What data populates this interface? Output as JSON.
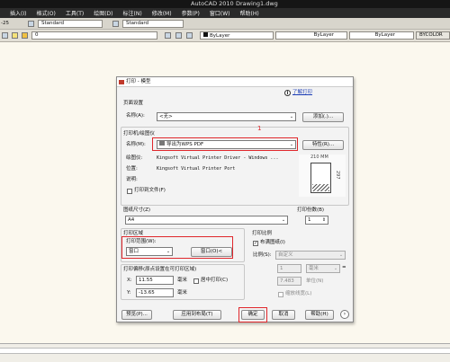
{
  "app": {
    "title": "AutoCAD 2010",
    "file": "Drawing1.dwg"
  },
  "menu": [
    "插入(I)",
    "格式(O)",
    "工具(T)",
    "绘图(D)",
    "标注(N)",
    "修改(M)",
    "参数(P)",
    "窗口(W)",
    "帮助(H)"
  ],
  "toolbar1": {
    "scale_label": "-25",
    "style1": "Standard",
    "style2": "Standard"
  },
  "toolbar2": {
    "layer_value": "0",
    "bylayer1": "ByLayer",
    "bylayer2": "ByLayer",
    "bylayer3": "ByLayer",
    "bycolor": "BYCOLOR"
  },
  "dialog": {
    "title": "打印 - 模型",
    "learn_link": "了解打印",
    "page_setup": {
      "section": "页面设置",
      "name_label": "名称(A):",
      "name_value": "<无>",
      "add_button": "添加(.)..."
    },
    "printer": {
      "section": "打印机/绘图仪",
      "name_label": "名称(M):",
      "name_value": "导出为WPS PDF",
      "properties_button": "特性(R)...",
      "plotter_label": "绘图仪:",
      "plotter_value": "Kingsoft Virtual Printer Driver - Windows ...",
      "location_label": "位置:",
      "location_value": "Kingsoft Virtual Printer Port",
      "description_label": "说明:",
      "print_to_file": "打印到文件(F)",
      "preview_width": "210 MM",
      "preview_height": "297"
    },
    "paper": {
      "section": "图纸尺寸(Z)",
      "value": "A4"
    },
    "copies": {
      "section": "打印份数(B)",
      "value": "1"
    },
    "area": {
      "section": "打印区域",
      "range_label": "打印范围(W):",
      "range_value": "窗口",
      "window_button": "窗口(O)<"
    },
    "offset": {
      "section": "打印偏移(原点设置在可打印区域)",
      "x_label": "X:",
      "x_value": "11.55",
      "x_unit": "毫米",
      "center": "居中打印(C)",
      "y_label": "Y:",
      "y_value": "-13.65",
      "y_unit": "毫米"
    },
    "scale": {
      "section": "打印比例",
      "fit": "布满图纸(I)",
      "ratio_label": "比例(S):",
      "ratio_value": "自定义",
      "val1": "1",
      "unit": "毫米",
      "val2": "7.483",
      "unit2": "单位(N)",
      "scale_lineweights": "缩放线宽(L)"
    },
    "buttons": {
      "preview": "预览(P)...",
      "apply": "应用到布局(T)",
      "ok": "确定",
      "cancel": "取消",
      "help": "帮助(H)"
    },
    "annotation_number": "1"
  },
  "colors": {
    "highlight": "#e0272c",
    "accent": "#c0392b"
  }
}
